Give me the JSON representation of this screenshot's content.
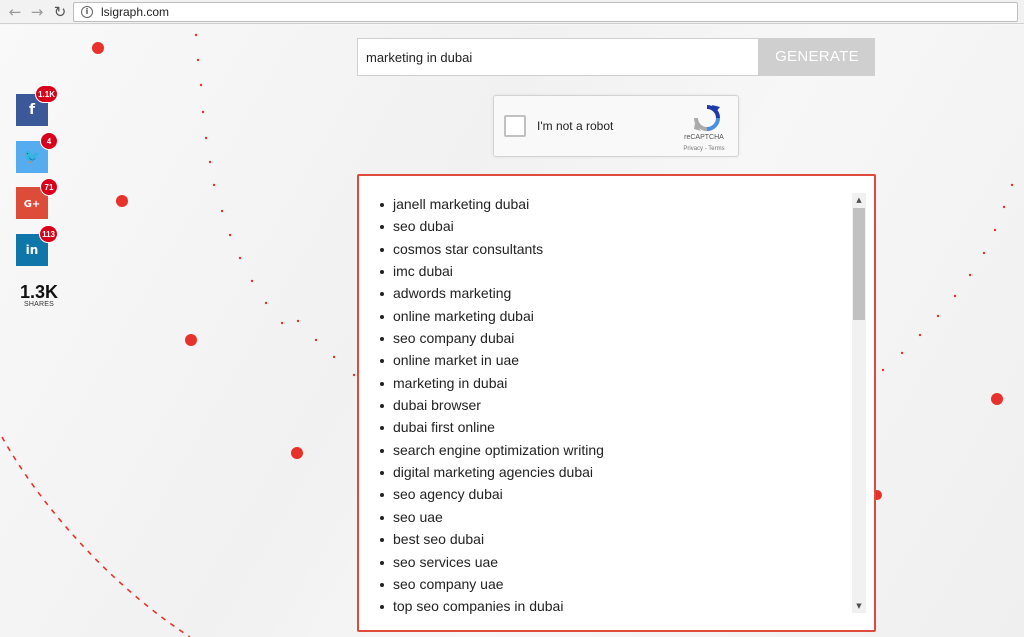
{
  "browser": {
    "url": "lsigraph.com",
    "back_glyph": "←",
    "forward_glyph": "→",
    "reload_glyph": "↻",
    "info_glyph": "i"
  },
  "share": {
    "facebook": {
      "icon": "facebook-icon",
      "glyph": "f",
      "count": "1.1K",
      "color": "#3b5998"
    },
    "twitter": {
      "icon": "twitter-icon",
      "glyph": "🐦",
      "count": "4",
      "color": "#55acee"
    },
    "googleplus": {
      "icon": "google-plus-icon",
      "glyph": "G+",
      "count": "71",
      "color": "#dd4b39"
    },
    "linkedin": {
      "icon": "linkedin-icon",
      "glyph": "in",
      "count": "113",
      "color": "#0e76a8"
    },
    "total_count": "1.3K",
    "total_label": "SHARES"
  },
  "search": {
    "value": "marketing in dubai",
    "button_label": "GENERATE"
  },
  "captcha": {
    "label": "I'm not a robot",
    "brand": "reCAPTCHA",
    "terms": "Privacy - Terms"
  },
  "results": [
    "janell marketing dubai",
    "seo dubai",
    "cosmos star consultants",
    "imc dubai",
    "adwords marketing",
    "online marketing dubai",
    "seo company dubai",
    "online market in uae",
    "marketing in dubai",
    "dubai browser",
    "dubai first online",
    "search engine optimization writing",
    "digital marketing agencies dubai",
    "seo agency dubai",
    "seo uae",
    "best seo dubai",
    "seo services uae",
    "seo company uae",
    "top seo companies in dubai"
  ],
  "scrollbar": {
    "up_glyph": "▲",
    "down_glyph": "▼",
    "position": 0
  },
  "colors": {
    "accent": "#e04a3c",
    "dot": "#e8312a",
    "button": "#cfcfcf"
  }
}
